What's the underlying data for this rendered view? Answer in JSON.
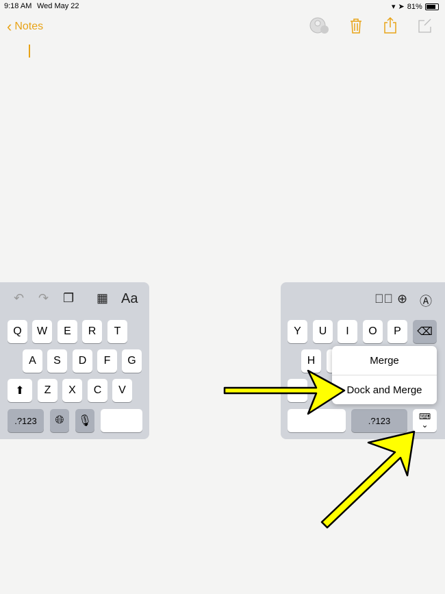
{
  "status_bar": {
    "time": "9:18 AM",
    "date": "Wed May 22",
    "battery": "81%"
  },
  "nav": {
    "back_label": "Notes",
    "icons": [
      "add-people-icon",
      "trash-icon",
      "share-icon",
      "compose-icon"
    ],
    "accent": "#e8a317"
  },
  "left_keyboard": {
    "toolbar": [
      "undo-icon",
      "redo-icon",
      "paste-icon",
      "table-icon"
    ],
    "format_label": "Aa",
    "row1": [
      "Q",
      "W",
      "E",
      "R",
      "T"
    ],
    "row2": [
      "A",
      "S",
      "D",
      "F",
      "G"
    ],
    "row3": [
      "Z",
      "X",
      "C",
      "V"
    ],
    "numbers_label": ".?123"
  },
  "right_keyboard": {
    "toolbar": [
      "checklist-icon",
      "add-icon",
      "markup-icon"
    ],
    "row1": [
      "Y",
      "U",
      "I",
      "O",
      "P"
    ],
    "row2": [
      "H"
    ],
    "numbers_label": ".?123"
  },
  "popup_menu": {
    "items": [
      "Merge",
      "Dock and Merge"
    ]
  },
  "annotation_color": "#ffff00"
}
